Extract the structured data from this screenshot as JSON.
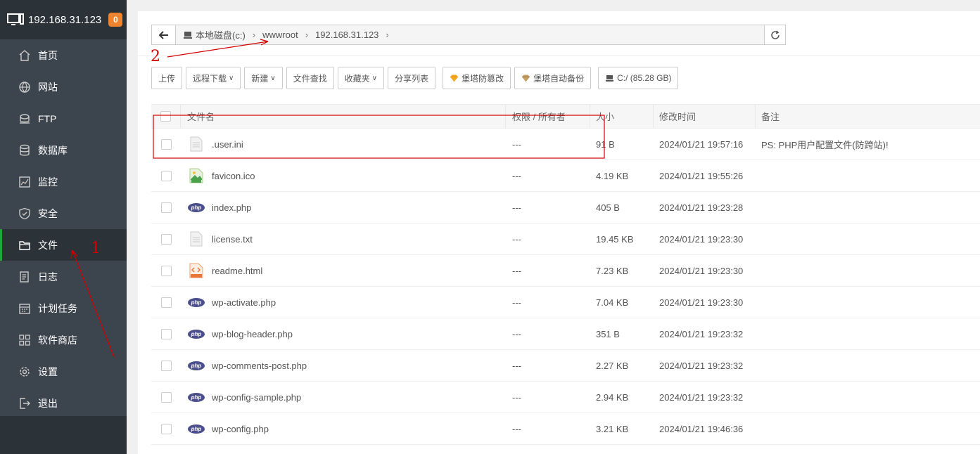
{
  "sidebar": {
    "host": "192.168.31.123",
    "badge": "0",
    "items": [
      {
        "label": "首页",
        "icon": "home-icon"
      },
      {
        "label": "网站",
        "icon": "globe-icon"
      },
      {
        "label": "FTP",
        "icon": "ftp-icon"
      },
      {
        "label": "数据库",
        "icon": "database-icon"
      },
      {
        "label": "监控",
        "icon": "monitor-chart-icon"
      },
      {
        "label": "安全",
        "icon": "shield-icon"
      },
      {
        "label": "文件",
        "icon": "folder-icon",
        "active": true
      },
      {
        "label": "日志",
        "icon": "log-icon"
      },
      {
        "label": "计划任务",
        "icon": "calendar-icon"
      },
      {
        "label": "软件商店",
        "icon": "apps-icon"
      },
      {
        "label": "设置",
        "icon": "gear-icon"
      },
      {
        "label": "退出",
        "icon": "logout-icon"
      }
    ]
  },
  "path": {
    "segments": [
      "本地磁盘(c:)",
      "wwwroot",
      "192.168.31.123"
    ]
  },
  "toolbar": {
    "upload": "上传",
    "remote_download": "远程下载",
    "new": "新建",
    "file_search": "文件查找",
    "favorites": "收藏夹",
    "share_list": "分享列表",
    "tamper_proof": "堡塔防篡改",
    "auto_backup": "堡塔自动备份",
    "disk": "C:/ (85.28 GB)"
  },
  "table": {
    "headers": {
      "name": "文件名",
      "perm": "权限 / 所有者",
      "size": "大小",
      "mtime": "修改时间",
      "note": "备注"
    },
    "rows": [
      {
        "name": ".user.ini",
        "type": "txt",
        "perm": "---",
        "size": "91 B",
        "mtime": "2024/01/21 19:57:16",
        "note": "PS: PHP用户配置文件(防跨站)!"
      },
      {
        "name": "favicon.ico",
        "type": "ico",
        "perm": "---",
        "size": "4.19 KB",
        "mtime": "2024/01/21 19:55:26",
        "note": ""
      },
      {
        "name": "index.php",
        "type": "php",
        "perm": "---",
        "size": "405 B",
        "mtime": "2024/01/21 19:23:28",
        "note": ""
      },
      {
        "name": "license.txt",
        "type": "txt",
        "perm": "---",
        "size": "19.45 KB",
        "mtime": "2024/01/21 19:23:30",
        "note": ""
      },
      {
        "name": "readme.html",
        "type": "html",
        "perm": "---",
        "size": "7.23 KB",
        "mtime": "2024/01/21 19:23:30",
        "note": ""
      },
      {
        "name": "wp-activate.php",
        "type": "php",
        "perm": "---",
        "size": "7.04 KB",
        "mtime": "2024/01/21 19:23:30",
        "note": ""
      },
      {
        "name": "wp-blog-header.php",
        "type": "php",
        "perm": "---",
        "size": "351 B",
        "mtime": "2024/01/21 19:23:32",
        "note": ""
      },
      {
        "name": "wp-comments-post.php",
        "type": "php",
        "perm": "---",
        "size": "2.27 KB",
        "mtime": "2024/01/21 19:23:32",
        "note": ""
      },
      {
        "name": "wp-config-sample.php",
        "type": "php",
        "perm": "---",
        "size": "2.94 KB",
        "mtime": "2024/01/21 19:23:32",
        "note": ""
      },
      {
        "name": "wp-config.php",
        "type": "php",
        "perm": "---",
        "size": "3.21 KB",
        "mtime": "2024/01/21 19:46:36",
        "note": ""
      }
    ]
  },
  "annotations": {
    "one": "1",
    "two": "2",
    "color": "#d40000"
  },
  "colors": {
    "sidebar_bg": "#3c444d",
    "active_accent": "#20a53a",
    "badge": "#f0832d"
  }
}
